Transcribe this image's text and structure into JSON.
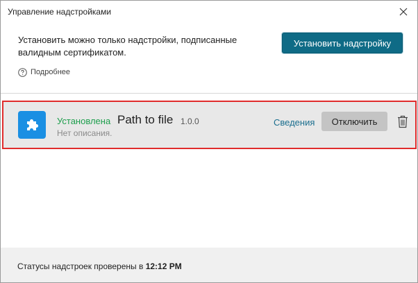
{
  "window": {
    "title": "Управление надстройками"
  },
  "notice": {
    "text": "Установить можно только надстройки, подписанные валидным сертификатом.",
    "more_link": "Подробнее"
  },
  "install_button": {
    "label": "Установить надстройку"
  },
  "addon": {
    "status": "Установлена",
    "name": "Path to file",
    "version": "1.0.0",
    "description": "Нет описания.",
    "details_label": "Сведения",
    "disable_label": "Отключить",
    "icon": "puzzle-icon"
  },
  "footer": {
    "status_prefix": "Статусы надстроек проверены в",
    "time": "12:12 PM"
  },
  "colors": {
    "accent": "#0f6b86",
    "status_installed": "#1e9e4d",
    "link": "#1a6e8e",
    "addon_icon_bg": "#1a8fe3",
    "selection_border": "#e02b2b"
  }
}
